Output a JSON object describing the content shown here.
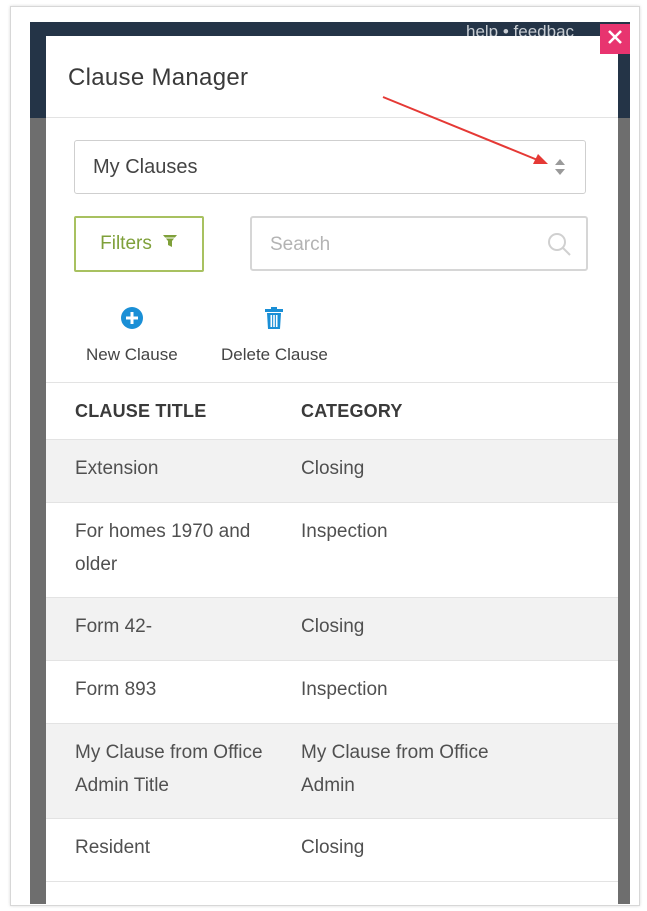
{
  "backdrop": {
    "header_text": "help • feedbac"
  },
  "modal": {
    "title": "Clause Manager",
    "close_icon": "close-icon"
  },
  "clause_select": {
    "value": "My Clauses",
    "icon": "sort-arrows-icon"
  },
  "filters": {
    "label": "Filters",
    "icon": "filter-icon"
  },
  "search": {
    "placeholder": "Search",
    "value": "",
    "icon": "search-icon"
  },
  "actions": {
    "new_clause": {
      "label": "New Clause",
      "icon": "plus-circle-icon"
    },
    "delete_clause": {
      "label": "Delete Clause",
      "icon": "trash-icon"
    }
  },
  "table": {
    "headers": [
      "CLAUSE TITLE",
      "CATEGORY"
    ],
    "rows": [
      {
        "title": "Extension",
        "category": "Closing"
      },
      {
        "title": "For homes 1970 and older",
        "category": "Inspection"
      },
      {
        "title": "Form 42-",
        "category": "Closing"
      },
      {
        "title": "Form 893",
        "category": "Inspection"
      },
      {
        "title": "My Clause from Office Admin Title",
        "category": "My Clause from Office Admin"
      },
      {
        "title": "Resident",
        "category": "Closing"
      }
    ]
  },
  "colors": {
    "close": "#e8346f",
    "filters": "#7fa03a",
    "action_icon": "#1a8fd6",
    "annotation_arrow": "#e53935"
  }
}
